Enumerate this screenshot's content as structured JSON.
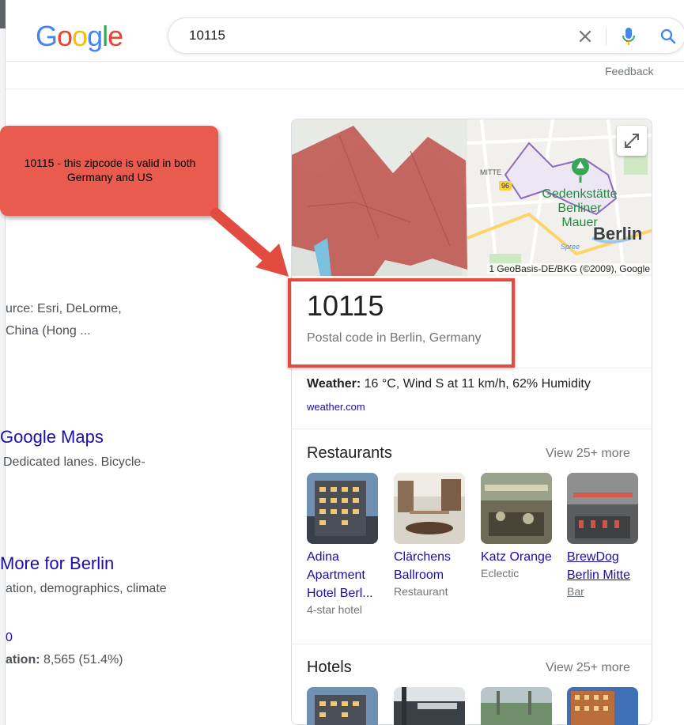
{
  "search": {
    "query": "10115",
    "logo_letters": [
      "G",
      "o",
      "o",
      "g",
      "l",
      "e"
    ],
    "logo_colors": [
      "#4285f4",
      "#ea4335",
      "#fbbc05",
      "#4285f4",
      "#34a853",
      "#ea4335"
    ]
  },
  "feedback_label": "Feedback",
  "left_results": {
    "source_line1": "urce: Esri, DeLorme,",
    "source_line2": "China (Hong ...",
    "maps_link": "Google Maps",
    "maps_snippet": "Dedicated lanes. Bicycle-",
    "more_link": "More for Berlin",
    "more_snippet": "ation, demographics, climate",
    "fragment": "0",
    "stat_label": "ation:",
    "stat_value": "8,565 (51.4%)"
  },
  "callout": {
    "text": "10115  - this zipcode is valid in both Germany and US"
  },
  "map": {
    "label_mitte": "MITTE",
    "road_number": "96",
    "place_line1": "Gedenkstätte",
    "place_line2": "Berliner Mauer",
    "city": "Berlin",
    "river": "Spree",
    "copyright": "1 GeoBasis-DE/BKG (©2009), Google",
    "accent_color": "#34a853",
    "region_color": "#c05b55"
  },
  "panel": {
    "title": "10115",
    "subtitle": "Postal code in Berlin, Germany",
    "weather_label": "Weather:",
    "weather_value": "16 °C, Wind S at 11 km/h, 62% Humidity",
    "weather_source": "weather.com"
  },
  "restaurants": {
    "heading": "Restaurants",
    "more": "View 25+ more",
    "items": [
      {
        "name": "Adina Apartment Hotel Berl...",
        "kind": "4-star hotel"
      },
      {
        "name": "Clärchens Ballroom",
        "kind": "Restaurant"
      },
      {
        "name": "Katz Orange",
        "kind": "Eclectic"
      },
      {
        "name": "BrewDog Berlin Mitte",
        "kind": "Bar"
      }
    ]
  },
  "hotels": {
    "heading": "Hotels",
    "more": "View 25+ more"
  }
}
